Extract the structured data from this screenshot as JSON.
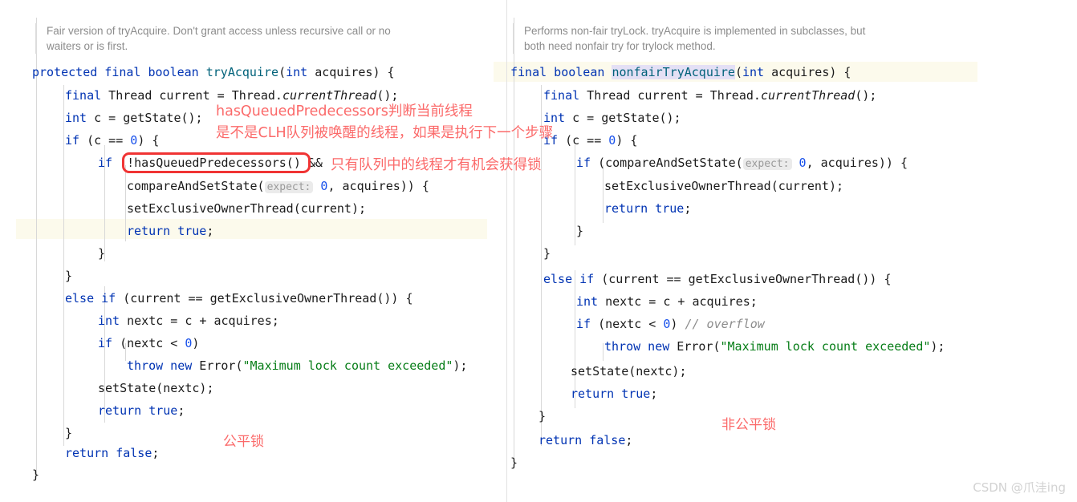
{
  "left_panel": {
    "doc_comment": {
      "line1": "Fair version of tryAcquire. Don't grant access unless recursive call or no",
      "line2": "waiters or is first."
    },
    "code_lines": [
      {
        "indent": 0,
        "text": "protected final boolean tryAcquire(int acquires) {"
      },
      {
        "indent": 1,
        "text": "final Thread current = Thread.currentThread();"
      },
      {
        "indent": 1,
        "text": "int c = getState();"
      },
      {
        "indent": 1,
        "text": "if (c == 0) {"
      },
      {
        "indent": 2,
        "text": "if (!hasQueuedPredecessors() &&"
      },
      {
        "indent": 3,
        "text": "compareAndSetState( expect: 0, acquires)) {"
      },
      {
        "indent": 3,
        "text": "setExclusiveOwnerThread(current);"
      },
      {
        "indent": 3,
        "text": "return true;"
      },
      {
        "indent": 2,
        "text": "}"
      },
      {
        "indent": 1,
        "text": "}"
      },
      {
        "indent": 1,
        "text": "else if (current == getExclusiveOwnerThread()) {"
      },
      {
        "indent": 2,
        "text": "int nextc = c + acquires;"
      },
      {
        "indent": 2,
        "text": "if (nextc < 0)"
      },
      {
        "indent": 3,
        "text": "throw new Error(\"Maximum lock count exceeded\");"
      },
      {
        "indent": 2,
        "text": "setState(nextc);"
      },
      {
        "indent": 2,
        "text": "return true;"
      },
      {
        "indent": 1,
        "text": "}"
      },
      {
        "indent": 1,
        "text": "return false;"
      },
      {
        "indent": 0,
        "text": "}"
      }
    ],
    "param_hint": "expect:",
    "highlighted_line": "return true;",
    "boxed_expression": "!hasQueuedPredecessors()",
    "label": "公平锁"
  },
  "right_panel": {
    "doc_comment": {
      "line1": "Performs non-fair tryLock. tryAcquire is implemented in subclasses, but",
      "line2": "both need nonfair try for trylock method."
    },
    "code_lines": [
      {
        "indent": 0,
        "text": "final boolean nonfairTryAcquire(int acquires) {"
      },
      {
        "indent": 1,
        "text": "final Thread current = Thread.currentThread();"
      },
      {
        "indent": 1,
        "text": "int c = getState();"
      },
      {
        "indent": 1,
        "text": "if (c == 0) {"
      },
      {
        "indent": 2,
        "text": "if (compareAndSetState( expect: 0, acquires)) {"
      },
      {
        "indent": 3,
        "text": "setExclusiveOwnerThread(current);"
      },
      {
        "indent": 3,
        "text": "return true;"
      },
      {
        "indent": 2,
        "text": "}"
      },
      {
        "indent": 1,
        "text": "}"
      },
      {
        "indent": 1,
        "text": "else if (current == getExclusiveOwnerThread()) {"
      },
      {
        "indent": 2,
        "text": "int nextc = c + acquires;"
      },
      {
        "indent": 2,
        "text": "if (nextc < 0) // overflow"
      },
      {
        "indent": 3,
        "text": "throw new Error(\"Maximum lock count exceeded\");"
      },
      {
        "indent": 2,
        "text": "setState(nextc);"
      },
      {
        "indent": 2,
        "text": "return true;"
      },
      {
        "indent": 1,
        "text": "}"
      },
      {
        "indent": 1,
        "text": "return false;"
      },
      {
        "indent": 0,
        "text": "}"
      }
    ],
    "param_hint": "expect:",
    "caret_identifier": "nonfairTryAcquire",
    "inline_comment": "// overflow",
    "label": "非公平锁"
  },
  "annotations": {
    "note1_line1": "hasQueuedPredecessors判断当前线程",
    "note1_line2": "是不是CLH队列被唤醒的线程，如果是执行下一个步骤",
    "note2": "只有队列中的线程才有机会获得锁"
  },
  "watermark": "CSDN @爪洼ing",
  "colors": {
    "keyword": "#0033B3",
    "method": "#00627A",
    "number": "#1750EB",
    "string": "#067D17",
    "comment": "#8C8C8C",
    "annotation_red": "#FB6A6A",
    "box_red": "#F03434",
    "caret_row": "#FCFAEC",
    "identifier_highlight": "#E4E0F5"
  }
}
